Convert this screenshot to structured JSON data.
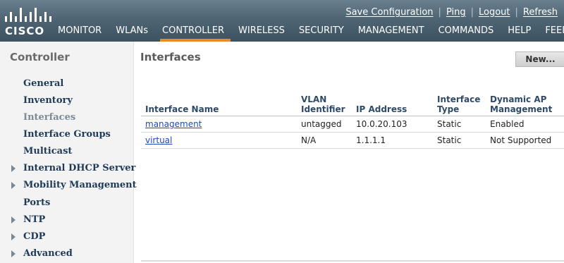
{
  "brand": {
    "logo_text": "CISCO"
  },
  "utility_links": [
    {
      "label": "Save Configuration"
    },
    {
      "label": "Ping"
    },
    {
      "label": "Logout"
    },
    {
      "label": "Refresh"
    }
  ],
  "nav": [
    {
      "label": "MONITOR"
    },
    {
      "label": "WLANs"
    },
    {
      "label": "CONTROLLER",
      "active": true
    },
    {
      "label": "WIRELESS"
    },
    {
      "label": "SECURITY"
    },
    {
      "label": "MANAGEMENT"
    },
    {
      "label": "COMMANDS"
    },
    {
      "label": "HELP"
    },
    {
      "label": "FEED"
    }
  ],
  "sidebar": {
    "title": "Controller",
    "items": [
      {
        "label": "General",
        "expandable": false,
        "active": false
      },
      {
        "label": "Inventory",
        "expandable": false,
        "active": false
      },
      {
        "label": "Interfaces",
        "expandable": false,
        "active": true
      },
      {
        "label": "Interface Groups",
        "expandable": false,
        "active": false
      },
      {
        "label": "Multicast",
        "expandable": false,
        "active": false
      },
      {
        "label": "Internal DHCP Server",
        "expandable": true,
        "active": false
      },
      {
        "label": "Mobility Management",
        "expandable": true,
        "active": false
      },
      {
        "label": "Ports",
        "expandable": false,
        "active": false
      },
      {
        "label": "NTP",
        "expandable": true,
        "active": false
      },
      {
        "label": "CDP",
        "expandable": true,
        "active": false
      },
      {
        "label": "Advanced",
        "expandable": true,
        "active": false
      }
    ]
  },
  "content": {
    "title": "Interfaces",
    "new_button": "New...",
    "table": {
      "headers": [
        "Interface Name",
        "VLAN\nIdentifier",
        "IP Address",
        "Interface\nType",
        "Dynamic AP\nManagement"
      ],
      "rows": [
        [
          "management",
          "untagged",
          "10.0.20.103",
          "Static",
          "Enabled"
        ],
        [
          "virtual",
          "N/A",
          "1.1.1.1",
          "Static",
          "Not Supported"
        ]
      ]
    }
  },
  "colors": {
    "header_bg": "#4f6573",
    "active_tab_indicator": "#e88a2a",
    "sidebar_bg": "#f3f3f3",
    "sidebar_text": "#1f3a57",
    "link": "#1f49b6"
  }
}
